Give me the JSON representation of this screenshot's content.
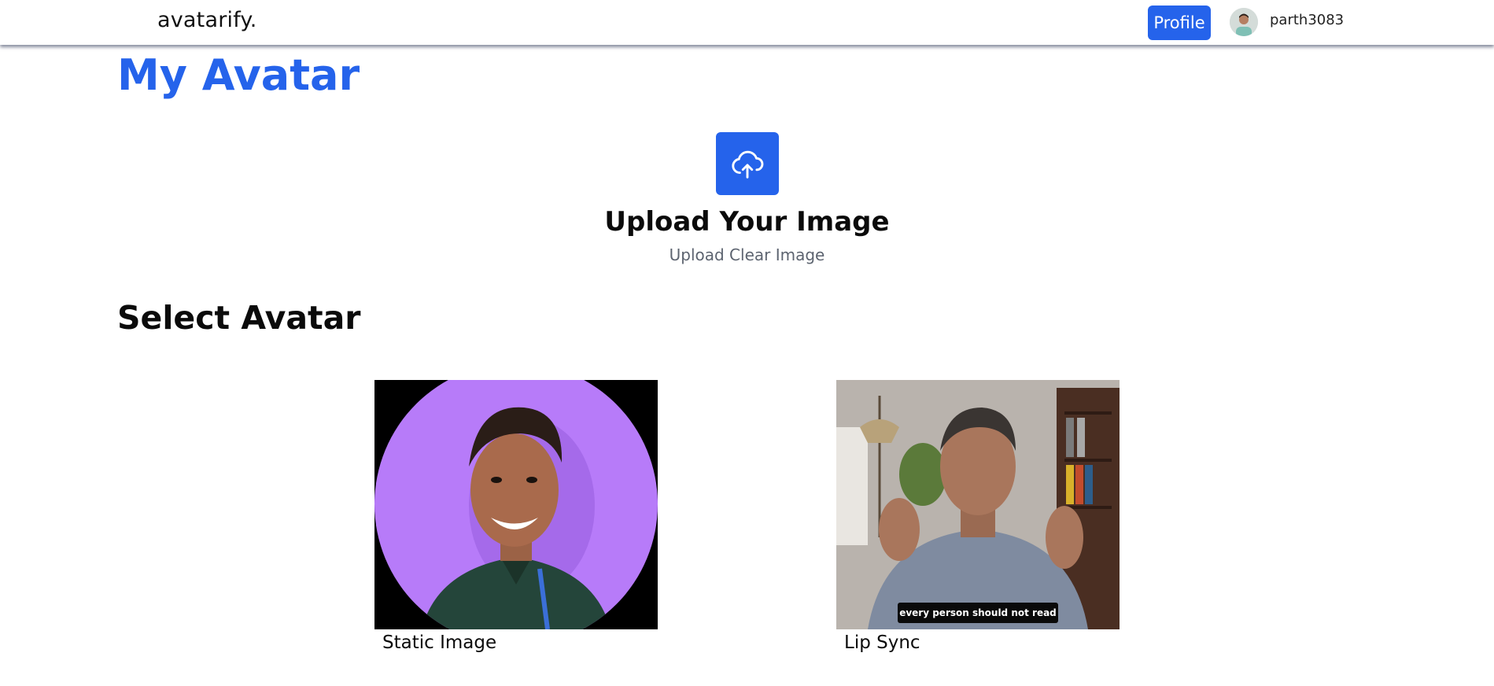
{
  "nav": {
    "brand": "avatarify.",
    "profile_label": "Profile",
    "username": "parth3083"
  },
  "page": {
    "title": "My Avatar"
  },
  "upload": {
    "title": "Upload Your Image",
    "subtitle": "Upload Clear Image",
    "icon": "cloud-upload-icon"
  },
  "select": {
    "title": "Select Avatar",
    "options": [
      {
        "label": "Static Image"
      },
      {
        "label": "Lip Sync",
        "caption": "every person should not read"
      }
    ]
  },
  "colors": {
    "accent": "#2563eb",
    "static_bg": "#b77bf9",
    "subtitle_text": "#5d6470"
  }
}
